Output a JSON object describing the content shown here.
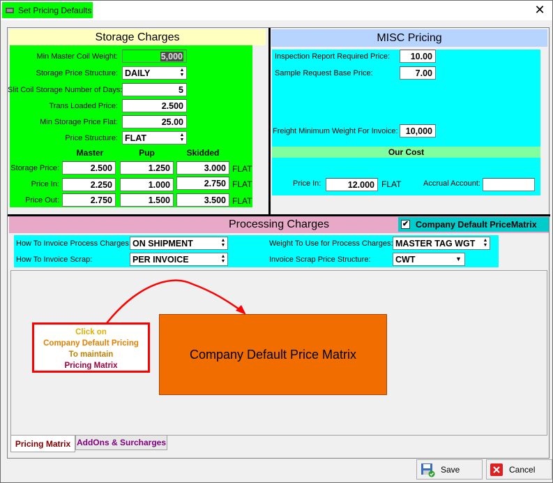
{
  "window": {
    "title": "Set Pricing Defaults"
  },
  "storage": {
    "header": "Storage Charges",
    "min_master_coil_weight": {
      "label": "Min Master Coil Weight:",
      "value": "5,000"
    },
    "storage_price_structure": {
      "label": "Storage Price Structure:",
      "value": "DAILY"
    },
    "slit_coil_days": {
      "label": "Slit Coil Storage Number of Days:",
      "value": "5"
    },
    "trans_loaded_price": {
      "label": "Trans Loaded Price:",
      "value": "2.500"
    },
    "min_storage_price_flat": {
      "label": "Min Storage Price Flat:",
      "value": "25.00"
    },
    "price_structure": {
      "label": "Price Structure:",
      "value": "FLAT"
    },
    "columns": [
      "Master",
      "Pup",
      "Skidded"
    ],
    "rows": [
      {
        "label": "Storage Price:",
        "values": [
          "2.500",
          "1.250",
          "3.000"
        ],
        "unit": "FLAT"
      },
      {
        "label": "Price In:",
        "values": [
          "2.250",
          "1.000",
          "2.750"
        ],
        "unit": "FLAT"
      },
      {
        "label": "Price Out:",
        "values": [
          "2.750",
          "1.500",
          "3.500"
        ],
        "unit": "FLAT"
      }
    ]
  },
  "misc": {
    "header": "MISC Pricing",
    "inspection_report": {
      "label": "Inspection Report Required Price:",
      "value": "10.00"
    },
    "sample_request": {
      "label": "Sample Request Base Price:",
      "value": "7.00"
    },
    "freight_min_weight": {
      "label": "Freight Minimum Weight For Invoice:",
      "value": "10,000"
    },
    "our_cost_header": "Our Cost",
    "price_in": {
      "label": "Price In:",
      "value": "12.000",
      "unit": "FLAT"
    },
    "accrual_account": {
      "label": "Accrual Account:",
      "value": ""
    }
  },
  "processing": {
    "header": "Processing Charges",
    "company_default_checkbox": "Company Default PriceMatrix",
    "how_invoice_process": {
      "label": "How To Invoice Process Charges:",
      "value": "ON SHIPMENT"
    },
    "how_invoice_scrap": {
      "label": "How To Invoice Scrap:",
      "value": "PER INVOICE"
    },
    "weight_for_process": {
      "label": "Weight To Use for Process Charges:",
      "value": "MASTER TAG WGT"
    },
    "invoice_scrap_structure": {
      "label": "Invoice Scrap Price Structure:",
      "value": "CWT"
    }
  },
  "callout": {
    "line1": "Click on",
    "line2": "Company Default Pricing",
    "line3": "To maintain",
    "line4": "Pricing  Matrix"
  },
  "matrix_button": "Company Default Price Matrix",
  "tabs": {
    "pricing_matrix": "Pricing Matrix",
    "addons": "AddOns & Surcharges"
  },
  "buttons": {
    "save": "Save",
    "cancel": "Cancel"
  },
  "colors": {
    "green": "#00ff00",
    "cyan": "#00ffff",
    "orange": "#f26d00",
    "callout_red": "#ff0000"
  }
}
